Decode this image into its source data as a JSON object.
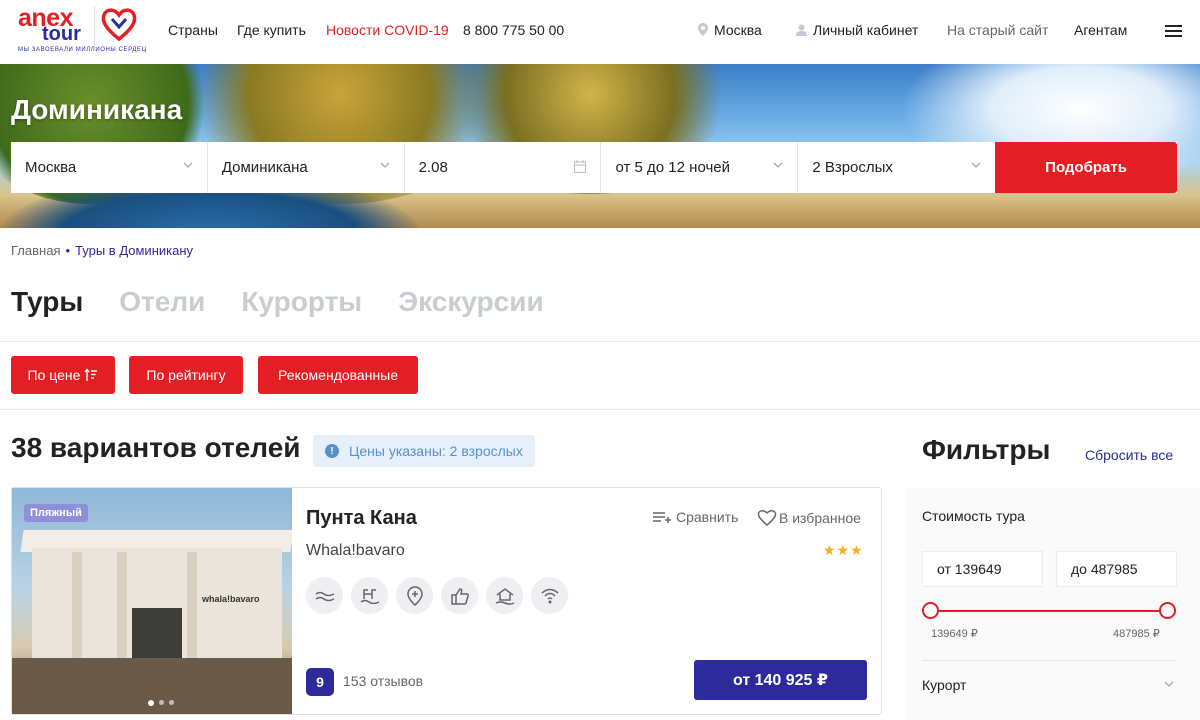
{
  "logo": {
    "brand": "anex",
    "brand2": "tour",
    "tagline": "МЫ ЗАВОЕВАЛИ МИЛЛИОНЫ СЕРДЕЦ"
  },
  "nav": {
    "countries": "Страны",
    "where_to_buy": "Где купить",
    "covid": "Новости COVID-19",
    "phone": "8 800 775 50 00",
    "city": "Москва",
    "account": "Личный кабинет",
    "old_site": "На старый сайт",
    "agents": "Агентам"
  },
  "hero": {
    "title": "Доминикана"
  },
  "search": {
    "from": "Москва",
    "destination": "Доминикана",
    "date": "2.08",
    "nights": "от 5 до 12 ночей",
    "travelers": "2 Взрослых",
    "submit": "Подобрать"
  },
  "breadcrumb": {
    "home": "Главная",
    "separator": "•",
    "current": "Туры в Доминикану"
  },
  "tabs": [
    "Туры",
    "Отели",
    "Курорты",
    "Экскурсии"
  ],
  "sort": {
    "by_price": "По цене",
    "by_rating": "По рейтингу",
    "recommended": "Рекомендованные"
  },
  "results": {
    "title": "38 вариантов отелей",
    "price_note": "Цены указаны: 2 взрослых"
  },
  "hotel": {
    "badge": "Пляжный",
    "photo_sign": "whala!bavaro",
    "name": "Пунта Кана",
    "subtitle": "Whala!bavaro",
    "stars": "★★★",
    "star_count": 3,
    "compare": "Сравнить",
    "favorite": "В избранное",
    "rating": "9",
    "reviews": "153 отзывов",
    "price": "от 140 925 ₽",
    "amenities": [
      "pool-icon",
      "swimming-icon",
      "location-icon",
      "thumbs-up-icon",
      "beach-house-icon",
      "wifi-icon"
    ],
    "photo_index": 1,
    "photo_count": 3
  },
  "filters": {
    "title": "Фильтры",
    "reset": "Сбросить все",
    "cost_label": "Стоимость тура",
    "from_value": "от 139649",
    "to_value": "до 487985",
    "min_label": "139649 ₽",
    "max_label": "487985 ₽",
    "resort": "Курорт"
  },
  "colors": {
    "accent_red": "#e31e24",
    "brand_blue": "#2d2a9b",
    "star": "#f2b01e"
  }
}
